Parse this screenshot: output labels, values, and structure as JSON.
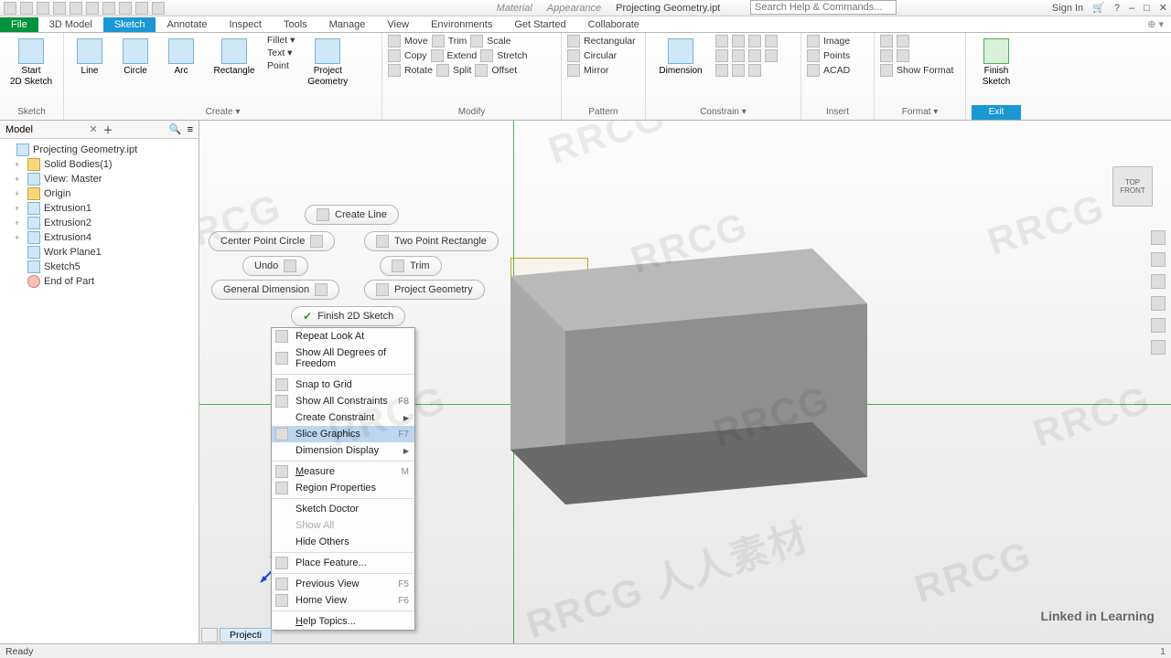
{
  "title": {
    "docname": "Projecting Geometry.ipt",
    "material": "Material",
    "appearance": "Appearance",
    "searchPlaceholder": "Search Help & Commands...",
    "signin": "Sign In"
  },
  "tabs": {
    "file": "File",
    "list": [
      "3D Model",
      "Sketch",
      "Annotate",
      "Inspect",
      "Tools",
      "Manage",
      "View",
      "Environments",
      "Get Started",
      "Collaborate"
    ],
    "activeIndex": 1
  },
  "ribbon": {
    "sketch": {
      "big": "Start\n2D Sketch",
      "label": "Sketch"
    },
    "create": {
      "items": [
        "Line",
        "Circle",
        "Arc",
        "Rectangle"
      ],
      "side": [
        "Fillet ▾",
        "Text ▾",
        "Point"
      ],
      "proj": "Project\nGeometry",
      "label": "Create ▾"
    },
    "modify": {
      "rows": [
        [
          "Move",
          "Trim",
          "Scale"
        ],
        [
          "Copy",
          "Extend",
          "Stretch"
        ],
        [
          "Rotate",
          "Split",
          "Offset"
        ]
      ],
      "label": "Modify"
    },
    "pattern": {
      "rows": [
        "Rectangular",
        "Circular",
        "Mirror"
      ],
      "label": "Pattern"
    },
    "dimension": {
      "big": "Dimension",
      "label": "Constrain ▾"
    },
    "insert": {
      "rows": [
        "Image",
        "Points",
        "ACAD"
      ],
      "label": "Insert"
    },
    "format": {
      "show": "Show Format",
      "label": "Format ▾"
    },
    "finish": {
      "big": "Finish\nSketch",
      "exit": "Exit"
    }
  },
  "browser": {
    "title": "Model",
    "root": "Projecting Geometry.ipt",
    "nodes": [
      {
        "label": "Solid Bodies(1)",
        "icon": "fic",
        "tw": "+"
      },
      {
        "label": "View: Master",
        "icon": "dic",
        "tw": "+"
      },
      {
        "label": "Origin",
        "icon": "fic",
        "tw": "+"
      },
      {
        "label": "Extrusion1",
        "icon": "dic",
        "tw": "+"
      },
      {
        "label": "Extrusion2",
        "icon": "dic",
        "tw": "+"
      },
      {
        "label": "Extrusion4",
        "icon": "dic",
        "tw": "+"
      },
      {
        "label": "Work Plane1",
        "icon": "dic",
        "tw": ""
      },
      {
        "label": "Sketch5",
        "icon": "dic",
        "tw": ""
      },
      {
        "label": "End of Part",
        "icon": "ric",
        "tw": ""
      }
    ]
  },
  "marking": {
    "createLine": "Create Line",
    "cpc": "Center Point Circle",
    "tpr": "Two Point Rectangle",
    "undo": "Undo",
    "trim": "Trim",
    "gdim": "General Dimension",
    "pg": "Project Geometry",
    "finish": "Finish 2D Sketch"
  },
  "ctx": {
    "items": [
      {
        "t": "Repeat Look At",
        "ic": 1
      },
      {
        "t": "Show All Degrees of Freedom",
        "ic": 1
      },
      {
        "sep": 1
      },
      {
        "t": "Snap to Grid",
        "ic": 1
      },
      {
        "t": "Show All Constraints",
        "ic": 1,
        "sc": "F8"
      },
      {
        "t": "Create Constraint",
        "sub": 1
      },
      {
        "t": "Slice Graphics",
        "ic": 1,
        "sc": "F7",
        "sel": 1
      },
      {
        "t": "Dimension Display",
        "sub": 1
      },
      {
        "sep": 1
      },
      {
        "t": "Measure",
        "ic": 1,
        "sc": "M",
        "u": 1
      },
      {
        "t": "Region Properties",
        "ic": 1
      },
      {
        "sep": 1
      },
      {
        "t": "Sketch Doctor"
      },
      {
        "t": "Show All",
        "dis": 1
      },
      {
        "t": "Hide Others"
      },
      {
        "sep": 1
      },
      {
        "t": "Place Feature...",
        "ic": 1
      },
      {
        "sep": 1
      },
      {
        "t": "Previous View",
        "ic": 1,
        "sc": "F5"
      },
      {
        "t": "Home View",
        "ic": 1,
        "sc": "F6"
      },
      {
        "sep": 1
      },
      {
        "t": "Help Topics...",
        "u": 1
      }
    ]
  },
  "navcube": {
    "top": "TOP",
    "front": "FRONT"
  },
  "doctab": "Projecti",
  "status": {
    "left": "Ready",
    "right": "1"
  },
  "brand": "Linked in Learning"
}
